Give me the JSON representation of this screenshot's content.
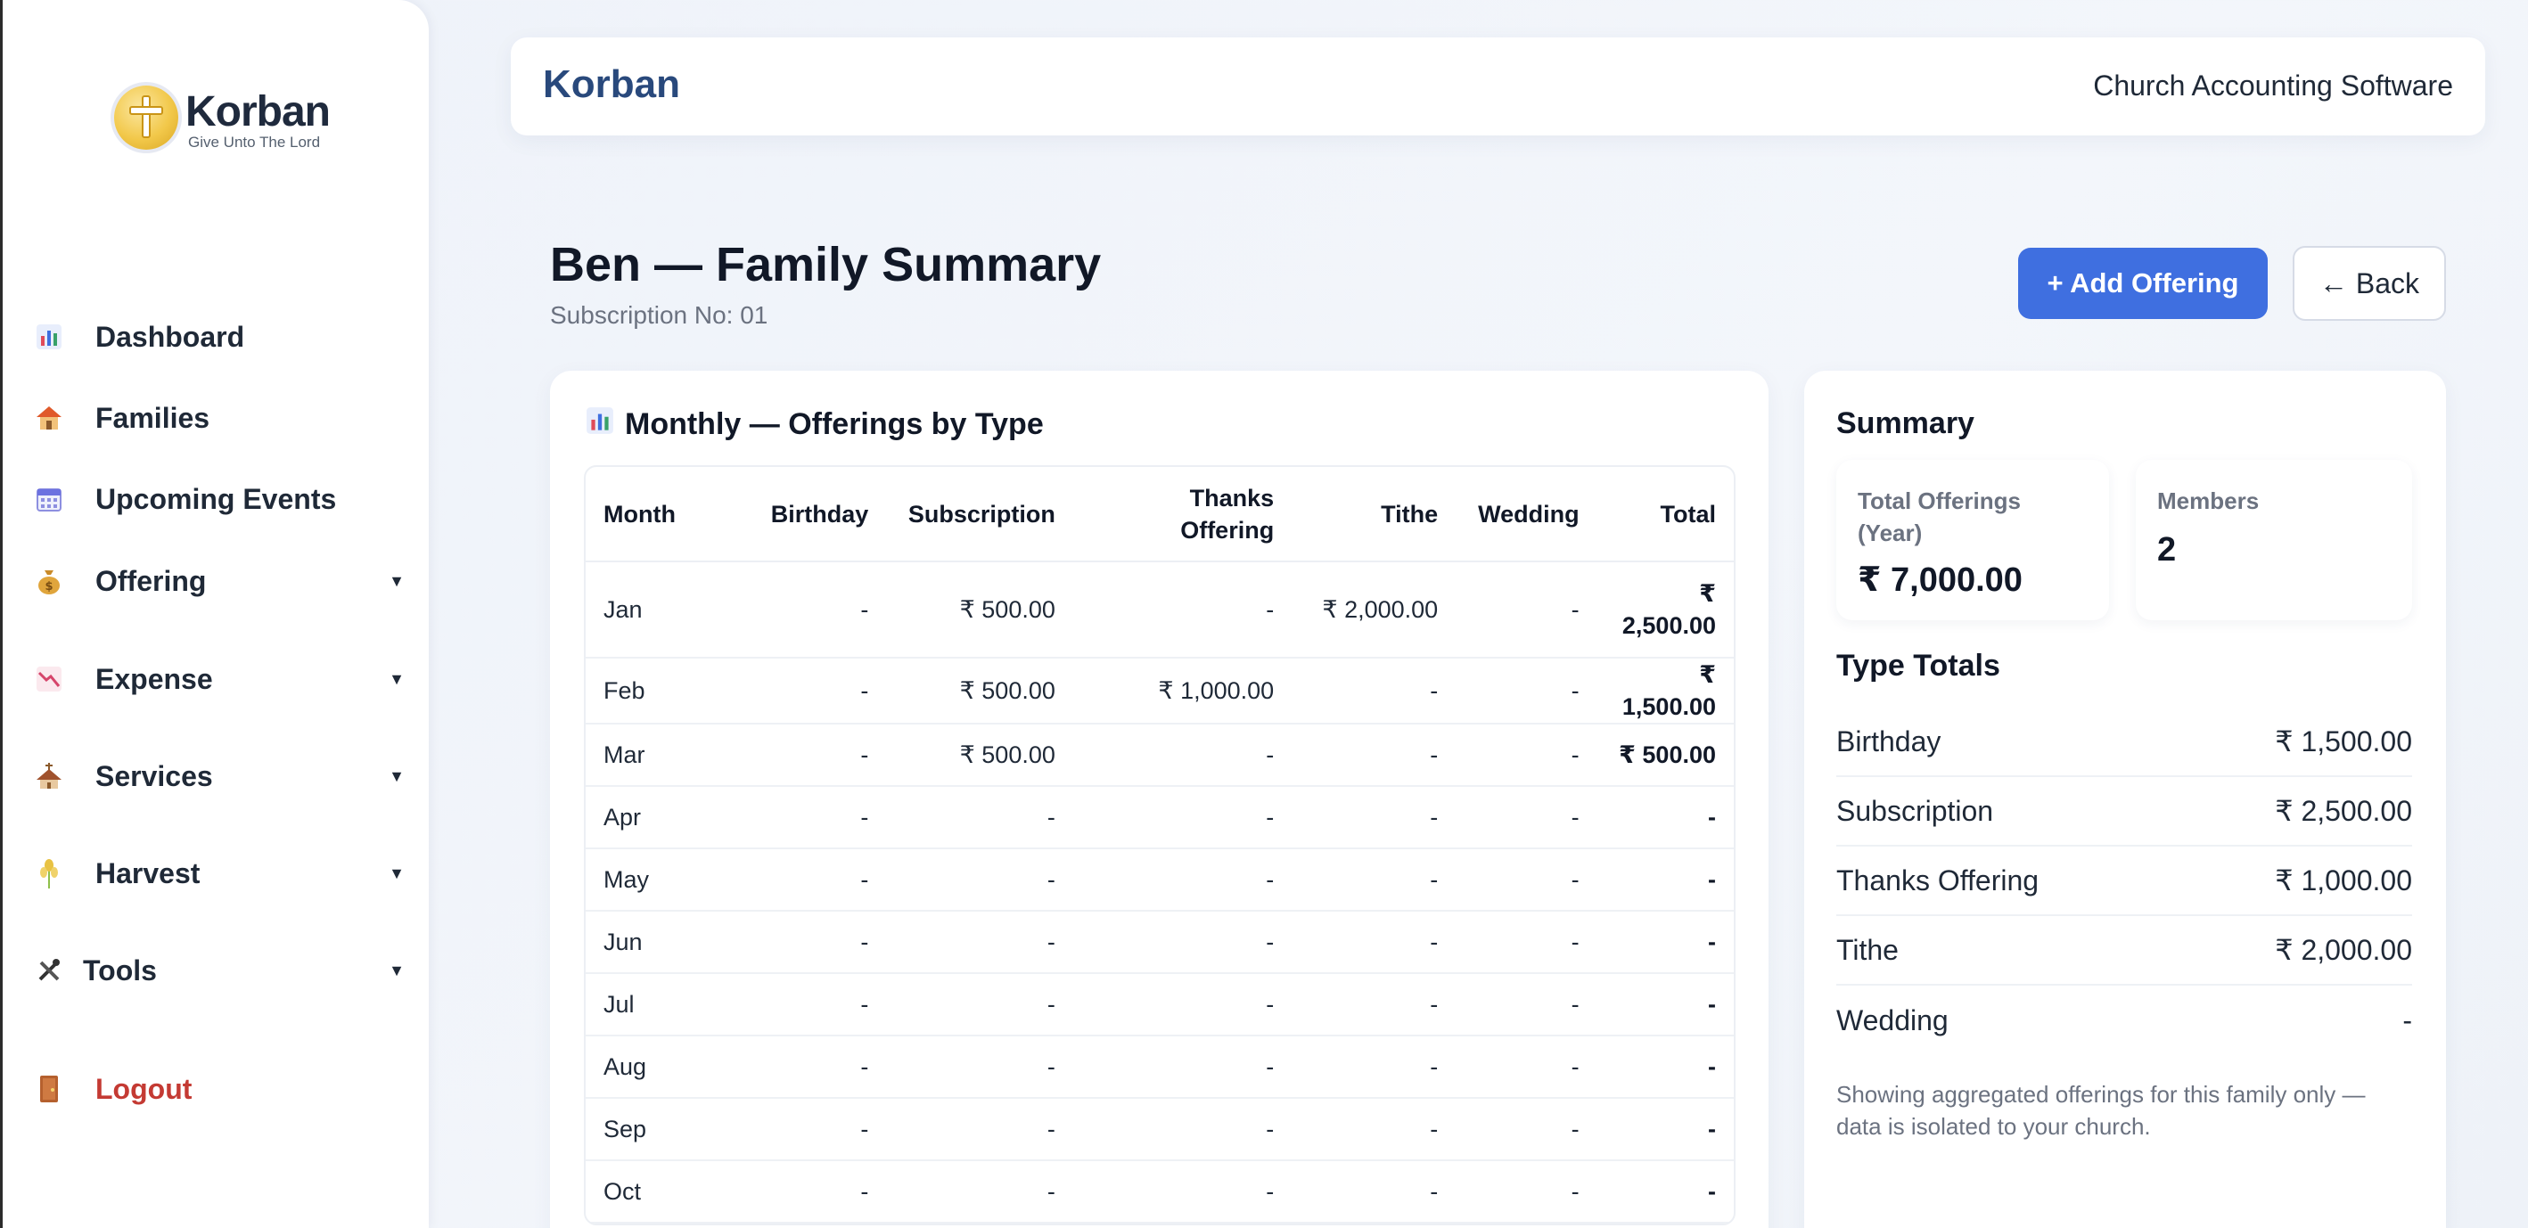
{
  "sidebar": {
    "logo": {
      "name": "Korban",
      "tagline": "Give Unto The Lord"
    },
    "items": [
      {
        "label": "Dashboard",
        "icon": "bar-chart-icon"
      },
      {
        "label": "Families",
        "icon": "house-icon"
      },
      {
        "label": "Upcoming Events",
        "icon": "calendar-icon"
      },
      {
        "label": "Offering",
        "icon": "money-bag-icon"
      },
      {
        "label": "Expense",
        "icon": "chart-down-icon"
      },
      {
        "label": "Services",
        "icon": "church-icon"
      },
      {
        "label": "Harvest",
        "icon": "wheat-icon"
      },
      {
        "label": "Tools",
        "icon": "tools-icon"
      },
      {
        "label": "Logout",
        "icon": "door-icon"
      }
    ]
  },
  "header": {
    "brand": "Korban",
    "tagline": "Church Accounting Software"
  },
  "page": {
    "title": "Ben — Family Summary",
    "subtitle": "Subscription No: 01",
    "add_label": "+ Add Offering",
    "back_label": "← Back"
  },
  "monthly": {
    "title": "Monthly — Offerings by Type",
    "columns": [
      "Month",
      "Birthday",
      "Subscription",
      "Thanks Offering",
      "Tithe",
      "Wedding",
      "Total"
    ],
    "rows": [
      [
        "Jan",
        "-",
        "₹ 500.00",
        "-",
        "₹ 2,000.00",
        "-",
        "₹ 2,500.00"
      ],
      [
        "Feb",
        "-",
        "₹ 500.00",
        "₹ 1,000.00",
        "-",
        "-",
        "₹ 1,500.00"
      ],
      [
        "Mar",
        "-",
        "₹ 500.00",
        "-",
        "-",
        "-",
        "₹ 500.00"
      ],
      [
        "Apr",
        "-",
        "-",
        "-",
        "-",
        "-",
        "-"
      ],
      [
        "May",
        "-",
        "-",
        "-",
        "-",
        "-",
        "-"
      ],
      [
        "Jun",
        "-",
        "-",
        "-",
        "-",
        "-",
        "-"
      ],
      [
        "Jul",
        "-",
        "-",
        "-",
        "-",
        "-",
        "-"
      ],
      [
        "Aug",
        "-",
        "-",
        "-",
        "-",
        "-",
        "-"
      ],
      [
        "Sep",
        "-",
        "-",
        "-",
        "-",
        "-",
        "-"
      ],
      [
        "Oct",
        "-",
        "-",
        "-",
        "-",
        "-",
        "-"
      ]
    ]
  },
  "summary": {
    "title": "Summary",
    "total_label": "Total Offerings (Year)",
    "total_value": "₹ 7,000.00",
    "members_label": "Members",
    "members_value": "2",
    "types_title": "Type Totals",
    "types": [
      {
        "label": "Birthday",
        "value": "₹ 1,500.00"
      },
      {
        "label": "Subscription",
        "value": "₹ 2,500.00"
      },
      {
        "label": "Thanks Offering",
        "value": "₹ 1,000.00"
      },
      {
        "label": "Tithe",
        "value": "₹ 2,000.00"
      },
      {
        "label": "Wedding",
        "value": "-"
      }
    ],
    "note": "Showing aggregated offerings for this family only — data is isolated to your church."
  }
}
